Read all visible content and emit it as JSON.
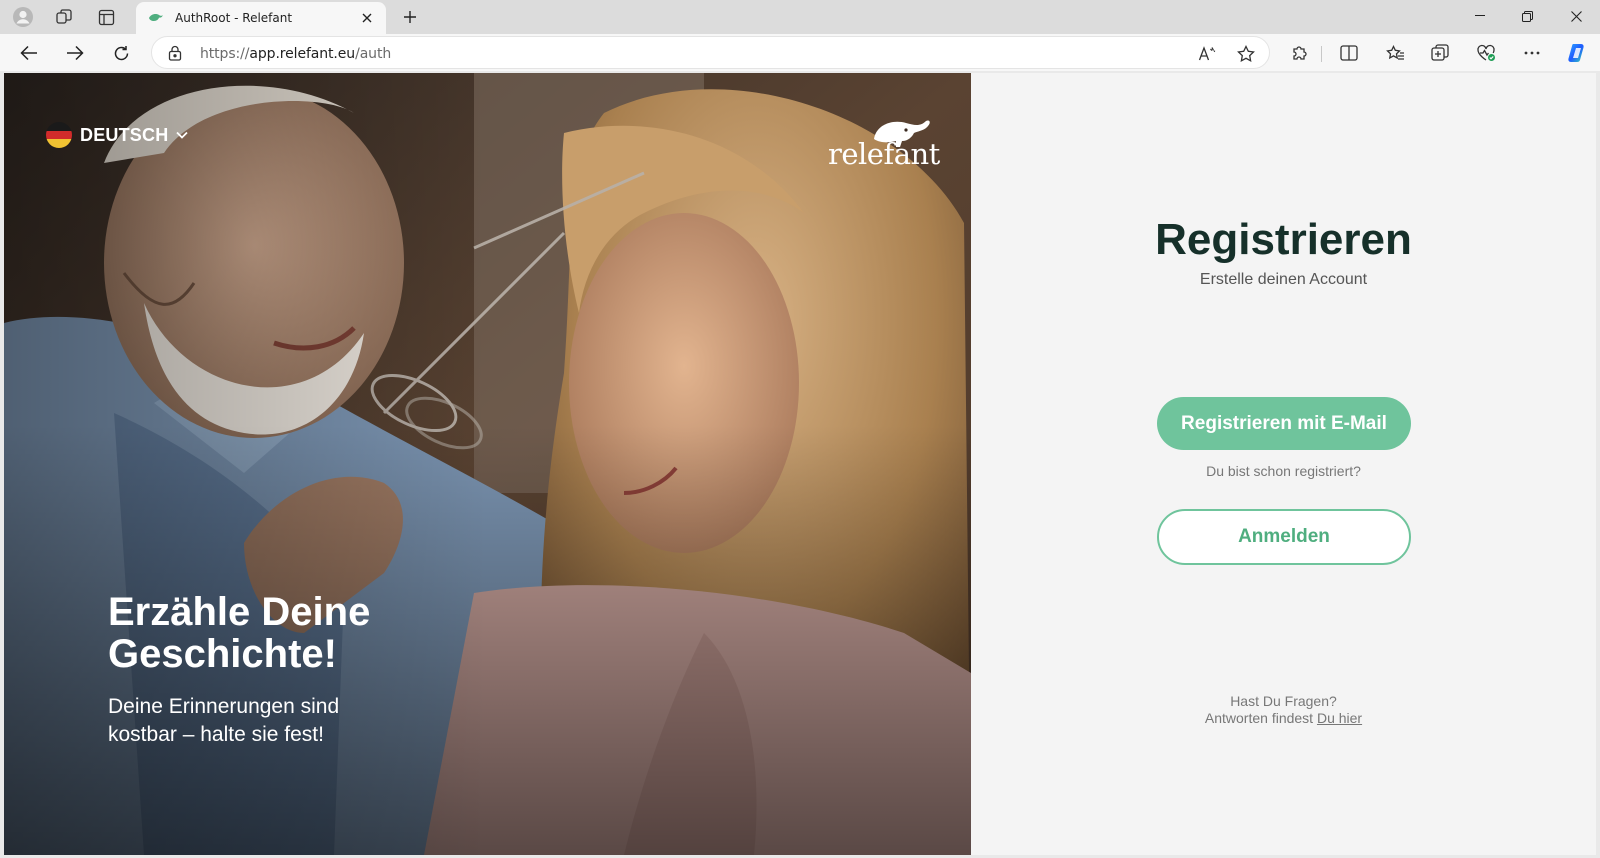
{
  "browser": {
    "tab_title": "AuthRoot - Relefant",
    "url_prefix": "https://",
    "url_host": "app.relefant.eu",
    "url_path": "/auth"
  },
  "hero": {
    "language": "DEUTSCH",
    "logo_text": "relefant",
    "headline": "Erzähle Deine Geschichte!",
    "tagline": "Deine Erinnerungen sind kostbar – halte sie fest!"
  },
  "auth": {
    "title": "Registrieren",
    "subtitle": "Erstelle deinen Account",
    "register_email_label": "Registrieren mit E-Mail",
    "already_registered": "Du bist schon registriert?",
    "login_label": "Anmelden",
    "faq_question": "Hast Du Fragen?",
    "faq_answer_prefix": "Antworten findest ",
    "faq_link": "Du hier"
  },
  "colors": {
    "accent": "#6fc49c",
    "title": "#16302a"
  }
}
